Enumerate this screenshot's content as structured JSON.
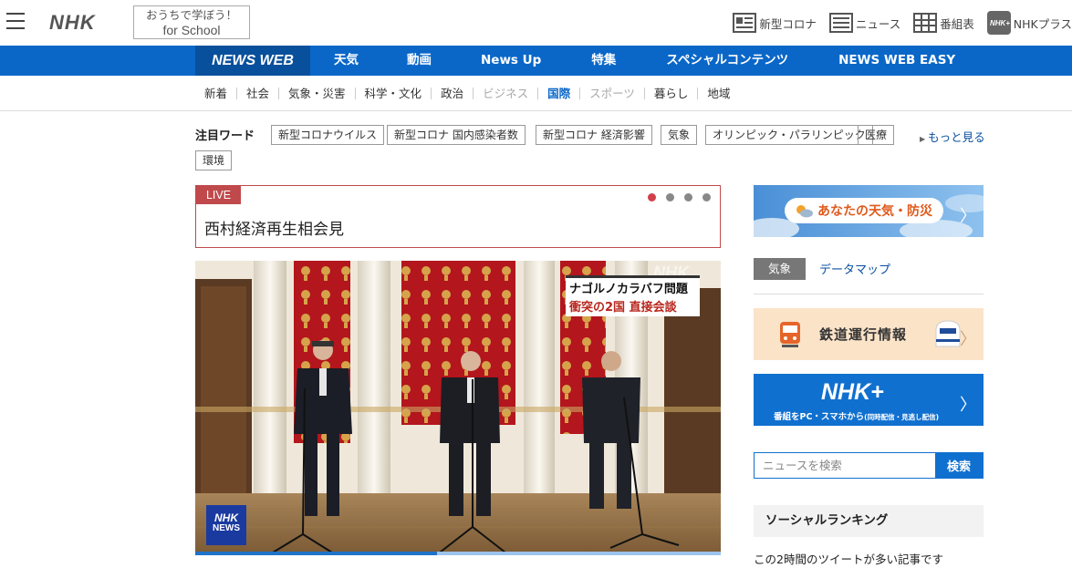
{
  "header": {
    "logo": "NHK",
    "school_line1": "おうちで学ぼう！",
    "school_line2": "for School",
    "links": [
      {
        "label": "新型コロナ",
        "icon": "virus-info-icon"
      },
      {
        "label": "ニュース",
        "icon": "newspaper-icon"
      },
      {
        "label": "番組表",
        "icon": "grid-schedule-icon"
      },
      {
        "label": "NHKプラス",
        "icon": "nhk-plus-icon"
      }
    ]
  },
  "nav": {
    "brand": "NEWS WEB",
    "items": [
      "天気",
      "動画",
      "News Up",
      "特集",
      "スペシャルコンテンツ",
      "NEWS WEB EASY"
    ]
  },
  "subnav": {
    "items": [
      "新着",
      "社会",
      "気象・災害",
      "科学・文化",
      "政治",
      "ビジネス",
      "国際",
      "スポーツ",
      "暮らし",
      "地域"
    ]
  },
  "keywords": {
    "label": "注目ワード",
    "tags": [
      "新型コロナウイルス",
      "新型コロナ 国内感染者数",
      "新型コロナ 経済影響",
      "気象",
      "オリンピック・パラリンピック",
      "医療",
      "環境"
    ],
    "more": "もっと見る"
  },
  "live": {
    "badge": "LIVE",
    "title": "西村経済再生相会見",
    "active_dot": 0,
    "dot_count": 4
  },
  "video": {
    "caption_line1": "ナゴルノカラバフ問題",
    "caption_line2": "衝突の2国 直接会談",
    "watermark": "NHK",
    "badge_line1": "NHK",
    "badge_line2": "NEWS",
    "progress": 0.46
  },
  "sidebar": {
    "tenki_banner": "あなたの天気・防災",
    "kisho_tag": "気象",
    "datamap_link": "データマップ",
    "tetsudo_banner": "鉄道運行情報",
    "nhkplus_big": "NHK+",
    "nhkplus_small_main": "番組をPC・スマホから",
    "nhkplus_small_note": "(同時配信・見逃し配信)",
    "search_placeholder": "ニュースを検索",
    "search_button": "検索",
    "social_title": "ソーシャルランキング",
    "social_subtitle": "この2時間のツイートが多い記事です"
  },
  "colors": {
    "nav_blue": "#0a67c8",
    "brand_blue": "#08509c",
    "live_red": "#c0494b",
    "link_blue": "#0a4fa0"
  }
}
